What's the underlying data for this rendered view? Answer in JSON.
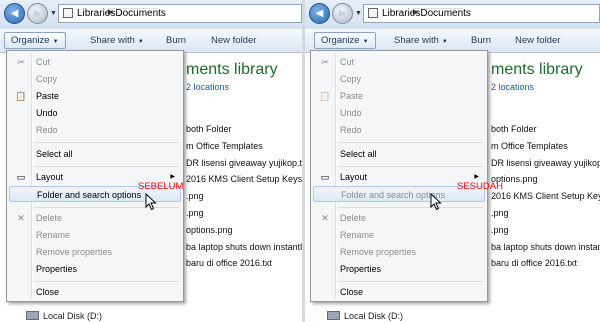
{
  "address": {
    "crumbs": [
      "Libraries",
      "Documents"
    ]
  },
  "toolbar": {
    "organize": "Organize",
    "share": "Share with",
    "burn": "Burn",
    "new_folder": "New folder"
  },
  "library": {
    "title": "ments library",
    "subtitle": "2 locations"
  },
  "files": [
    "both Folder",
    "m Office Templates",
    "DR lisensi giveaway yujikop.txt",
    "2016 KMS Client Setup Keys.txt",
    "options.png",
    ".png",
    ".png",
    "ba laptop shuts down instantly",
    "baru di office 2016.txt"
  ],
  "files_right": [
    "both Folder",
    "m Office Templates",
    "DR lisensi giveaway yujikop.txt",
    "2016 KMS Client Setup Keys.txt",
    "options.png",
    ".png",
    ".png",
    "ba laptop shuts down instantly",
    "baru di office 2016.txt"
  ],
  "drive": "Local Disk (D:)",
  "menu": {
    "cut": "Cut",
    "copy": "Copy",
    "paste": "Paste",
    "undo": "Undo",
    "redo": "Redo",
    "select_all": "Select all",
    "layout": "Layout",
    "folder_options": "Folder and search options",
    "delete": "Delete",
    "rename": "Rename",
    "remove_properties": "Remove properties",
    "properties": "Properties",
    "close": "Close"
  },
  "labels": {
    "before": "SEBELUM",
    "after": "SESUDAH"
  },
  "colors": {
    "accent_red": "#ff0000",
    "library_green": "#1e6b2e",
    "link_blue": "#1b5fa9"
  }
}
